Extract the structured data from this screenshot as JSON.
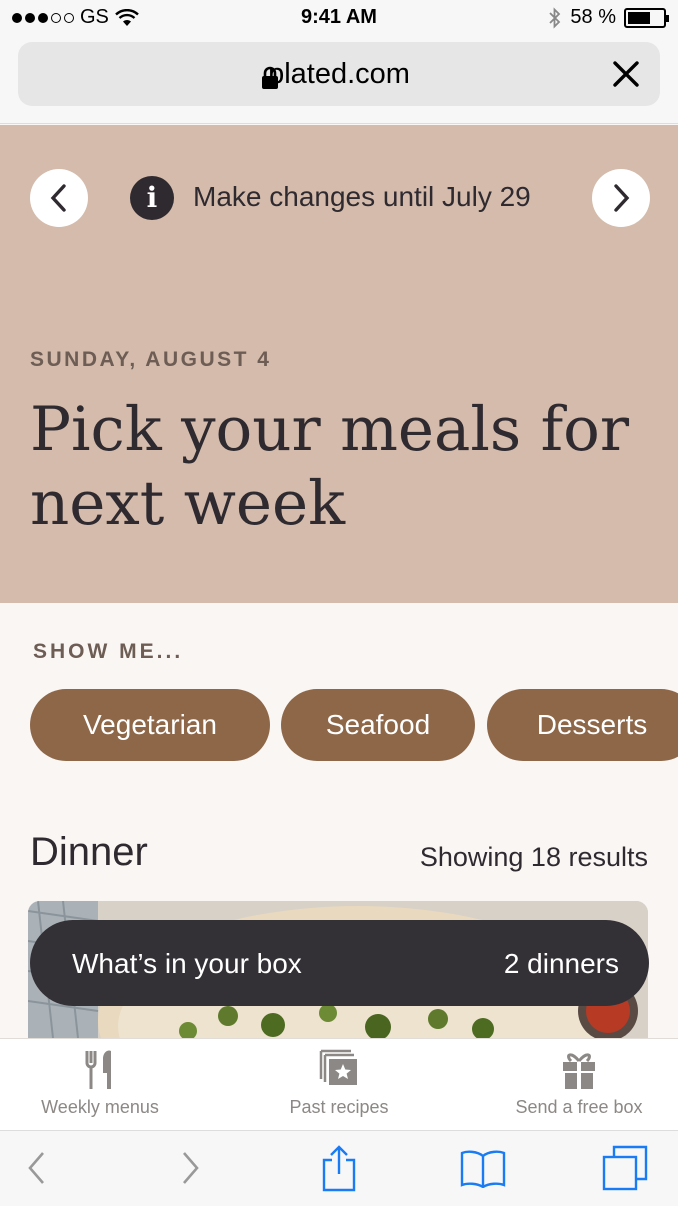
{
  "status_bar": {
    "carrier": "GS",
    "time": "9:41 AM",
    "battery": "58 %",
    "battery_level": 0.58
  },
  "browser": {
    "url": "plated.com"
  },
  "hero": {
    "deadline": "Make changes until July 29",
    "info_icon_glyph": "i",
    "date_label": "SUNDAY, AUGUST 4",
    "title": "Pick your meals for next week"
  },
  "filters": {
    "heading": "SHOW ME...",
    "chips": [
      "Vegetarian",
      "Seafood",
      "Desserts"
    ]
  },
  "dinner": {
    "heading": "Dinner",
    "results": "Showing 18 results"
  },
  "box_bar": {
    "label": "What’s in your box",
    "count": "2 dinners"
  },
  "tab_bar": {
    "items": [
      {
        "label": "Weekly menus",
        "icon": "fork-knife-icon"
      },
      {
        "label": "Past recipes",
        "icon": "recipe-stack-icon"
      },
      {
        "label": "Send a free box",
        "icon": "gift-icon"
      }
    ]
  },
  "colors": {
    "hero_bg": "#d4bbab",
    "chip_bg": "#8d6748",
    "box_bar_bg": "#333036",
    "safari_blue": "#1a7cf4"
  }
}
